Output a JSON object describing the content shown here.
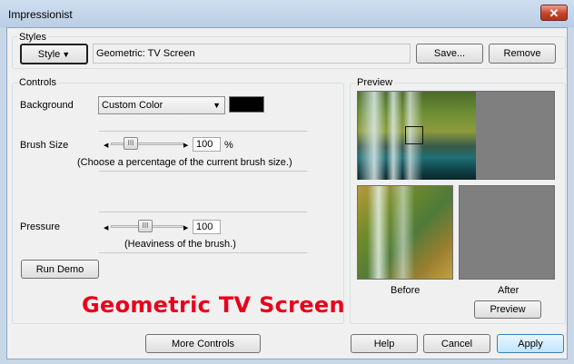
{
  "window": {
    "title": "Impressionist",
    "close_glyph": "✕"
  },
  "styles": {
    "group_label": "Styles",
    "style_button_label": "Style",
    "style_name": "Geometric: TV Screen",
    "save_label": "Save...",
    "remove_label": "Remove"
  },
  "controls": {
    "group_label": "Controls",
    "background_label": "Background",
    "background_value": "Custom Color",
    "background_color": "#000000",
    "brush_size_label": "Brush Size",
    "brush_size_value": "100",
    "brush_size_unit": "%",
    "brush_size_hint": "(Choose a percentage of the current brush size.)",
    "pressure_label": "Pressure",
    "pressure_value": "100",
    "pressure_hint": "(Heaviness of the brush.)",
    "run_demo_label": "Run Demo"
  },
  "preview": {
    "group_label": "Preview",
    "before_label": "Before",
    "after_label": "After",
    "preview_button_label": "Preview"
  },
  "footer": {
    "more_controls_label": "More Controls",
    "help_label": "Help",
    "cancel_label": "Cancel",
    "apply_label": "Apply"
  },
  "overlay_caption": "Geometric TV Screen"
}
